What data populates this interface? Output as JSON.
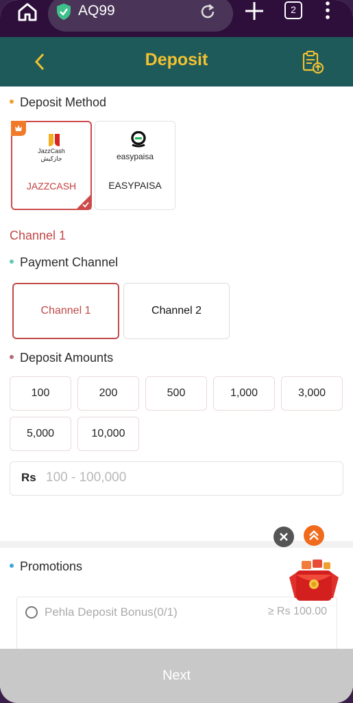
{
  "browser": {
    "url": "AQ99",
    "tab_count": "2",
    "icons": [
      "home-icon",
      "shield-check-icon",
      "reload-icon",
      "plus-icon",
      "tabs-icon",
      "more-vertical-icon"
    ]
  },
  "header": {
    "title": "Deposit",
    "icons": [
      "back-chevron-icon",
      "deposit-history-icon"
    ]
  },
  "deposit_method": {
    "title": "Deposit Method",
    "dot_color": "#f0a030",
    "methods": [
      {
        "label": "JAZZCASH",
        "logo_text": "JazzCash",
        "logo_urdu": "جازکیش",
        "selected": true
      },
      {
        "label": "EASYPAISA",
        "logo_text": "easypaisa",
        "selected": false
      }
    ]
  },
  "selected_channel": "Channel 1",
  "payment_channel": {
    "title": "Payment Channel",
    "dot_color": "#5fc9b5",
    "channels": [
      {
        "label": "Channel 1",
        "selected": true
      },
      {
        "label": "Channel 2",
        "selected": false
      }
    ]
  },
  "deposit_amounts": {
    "title": "Deposit Amounts",
    "dot_color": "#b56a7a",
    "amounts": [
      "100",
      "200",
      "500",
      "1,000",
      "3,000",
      "5,000",
      "10,000"
    ],
    "currency": "Rs",
    "placeholder": "100 - 100,000"
  },
  "promotions": {
    "title": "Promotions",
    "dot_color": "#3aa6d8",
    "items": [
      {
        "label": "Pehla Deposit Bonus(0/1)",
        "minimum": "≥ Rs 100.00"
      }
    ]
  },
  "next_label": "Next",
  "colors": {
    "header_bg": "#1f5a5a",
    "accent_yellow": "#f2c230",
    "accent_red": "#c14848",
    "browser_bg": "#2e0f3c"
  }
}
